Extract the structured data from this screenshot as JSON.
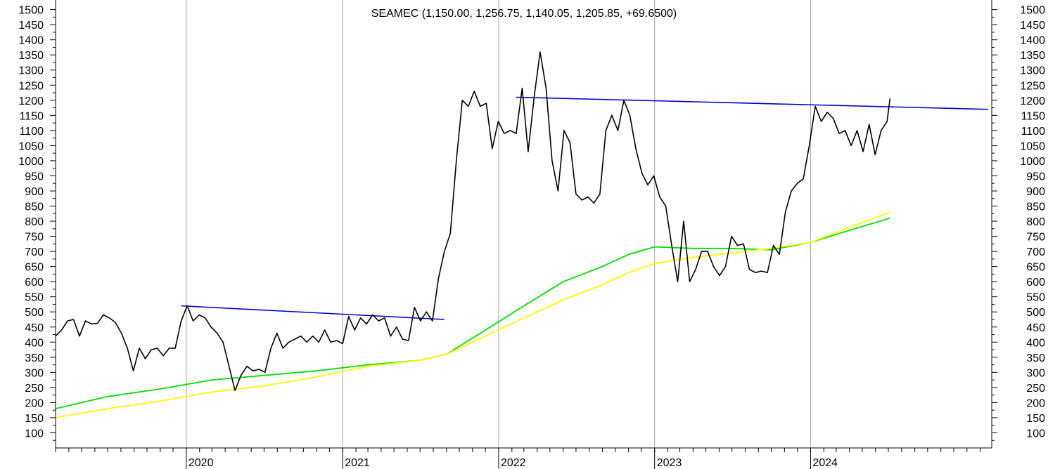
{
  "chart_data": {
    "type": "line",
    "title": "SEAMEC (1,150.00, 1,256.75, 1,140.05, 1,205.85, +69.6500)",
    "xlabel": "",
    "ylabel": "",
    "ylim": [
      50,
      1520
    ],
    "xlim": [
      "2019-03-01",
      "2025-02-28"
    ],
    "yticks": [
      100,
      150,
      200,
      250,
      300,
      350,
      400,
      450,
      500,
      550,
      600,
      650,
      700,
      750,
      800,
      850,
      900,
      950,
      1000,
      1050,
      1100,
      1150,
      1200,
      1250,
      1300,
      1350,
      1400,
      1450,
      1500
    ],
    "year_ticks": [
      {
        "date": "2020-01-01",
        "label": "2020"
      },
      {
        "date": "2021-01-01",
        "label": "2021"
      },
      {
        "date": "2022-01-01",
        "label": "2022"
      },
      {
        "date": "2023-01-01",
        "label": "2023"
      },
      {
        "date": "2024-01-01",
        "label": "2024"
      }
    ],
    "grid": "vertical-years",
    "colors": {
      "price": "#000000",
      "ma_fast": "#00dd00",
      "ma_slow": "#ffff00",
      "trendline": "#0000cc",
      "grid": "#b0b0b0"
    },
    "series": [
      {
        "key": "price",
        "points": [
          [
            "2019-03-01",
            420
          ],
          [
            "2019-03-15",
            440
          ],
          [
            "2019-03-29",
            470
          ],
          [
            "2019-04-12",
            475
          ],
          [
            "2019-04-26",
            420
          ],
          [
            "2019-05-10",
            470
          ],
          [
            "2019-05-24",
            460
          ],
          [
            "2019-06-07",
            462
          ],
          [
            "2019-06-21",
            490
          ],
          [
            "2019-07-05",
            480
          ],
          [
            "2019-07-19",
            465
          ],
          [
            "2019-08-02",
            430
          ],
          [
            "2019-08-16",
            380
          ],
          [
            "2019-08-30",
            305
          ],
          [
            "2019-09-13",
            380
          ],
          [
            "2019-09-27",
            345
          ],
          [
            "2019-10-11",
            375
          ],
          [
            "2019-10-25",
            380
          ],
          [
            "2019-11-08",
            355
          ],
          [
            "2019-11-22",
            380
          ],
          [
            "2019-12-06",
            380
          ],
          [
            "2019-12-20",
            470
          ],
          [
            "2020-01-03",
            520
          ],
          [
            "2020-01-17",
            470
          ],
          [
            "2020-01-31",
            490
          ],
          [
            "2020-02-14",
            480
          ],
          [
            "2020-02-28",
            450
          ],
          [
            "2020-03-13",
            430
          ],
          [
            "2020-03-27",
            400
          ],
          [
            "2020-04-10",
            320
          ],
          [
            "2020-04-24",
            240
          ],
          [
            "2020-05-08",
            290
          ],
          [
            "2020-05-22",
            320
          ],
          [
            "2020-06-05",
            305
          ],
          [
            "2020-06-19",
            310
          ],
          [
            "2020-07-03",
            300
          ],
          [
            "2020-07-17",
            380
          ],
          [
            "2020-07-31",
            430
          ],
          [
            "2020-08-14",
            380
          ],
          [
            "2020-08-28",
            400
          ],
          [
            "2020-09-11",
            410
          ],
          [
            "2020-09-25",
            420
          ],
          [
            "2020-10-09",
            400
          ],
          [
            "2020-10-23",
            420
          ],
          [
            "2020-11-06",
            400
          ],
          [
            "2020-11-20",
            440
          ],
          [
            "2020-12-04",
            400
          ],
          [
            "2020-12-18",
            405
          ],
          [
            "2021-01-01",
            395
          ],
          [
            "2021-01-15",
            485
          ],
          [
            "2021-01-29",
            440
          ],
          [
            "2021-02-12",
            480
          ],
          [
            "2021-02-26",
            460
          ],
          [
            "2021-03-12",
            490
          ],
          [
            "2021-03-26",
            470
          ],
          [
            "2021-04-09",
            480
          ],
          [
            "2021-04-23",
            420
          ],
          [
            "2021-05-07",
            450
          ],
          [
            "2021-05-21",
            410
          ],
          [
            "2021-06-04",
            405
          ],
          [
            "2021-06-18",
            515
          ],
          [
            "2021-07-02",
            470
          ],
          [
            "2021-07-16",
            500
          ],
          [
            "2021-07-30",
            470
          ],
          [
            "2021-08-13",
            610
          ],
          [
            "2021-08-27",
            700
          ],
          [
            "2021-09-10",
            760
          ],
          [
            "2021-09-24",
            1000
          ],
          [
            "2021-10-08",
            1200
          ],
          [
            "2021-10-22",
            1180
          ],
          [
            "2021-11-05",
            1230
          ],
          [
            "2021-11-19",
            1180
          ],
          [
            "2021-12-03",
            1190
          ],
          [
            "2021-12-17",
            1040
          ],
          [
            "2021-12-31",
            1130
          ],
          [
            "2022-01-14",
            1090
          ],
          [
            "2022-01-28",
            1100
          ],
          [
            "2022-02-11",
            1090
          ],
          [
            "2022-02-25",
            1240
          ],
          [
            "2022-03-11",
            1030
          ],
          [
            "2022-03-25",
            1210
          ],
          [
            "2022-04-08",
            1360
          ],
          [
            "2022-04-22",
            1240
          ],
          [
            "2022-05-06",
            1000
          ],
          [
            "2022-05-20",
            900
          ],
          [
            "2022-06-03",
            1100
          ],
          [
            "2022-06-17",
            1060
          ],
          [
            "2022-07-01",
            890
          ],
          [
            "2022-07-15",
            870
          ],
          [
            "2022-07-29",
            880
          ],
          [
            "2022-08-12",
            860
          ],
          [
            "2022-08-26",
            890
          ],
          [
            "2022-09-09",
            1100
          ],
          [
            "2022-09-23",
            1150
          ],
          [
            "2022-10-07",
            1100
          ],
          [
            "2022-10-21",
            1200
          ],
          [
            "2022-11-04",
            1150
          ],
          [
            "2022-11-18",
            1040
          ],
          [
            "2022-12-02",
            960
          ],
          [
            "2022-12-16",
            920
          ],
          [
            "2022-12-30",
            950
          ],
          [
            "2023-01-13",
            880
          ],
          [
            "2023-01-27",
            850
          ],
          [
            "2023-02-10",
            720
          ],
          [
            "2023-02-24",
            600
          ],
          [
            "2023-03-10",
            800
          ],
          [
            "2023-03-24",
            600
          ],
          [
            "2023-04-07",
            640
          ],
          [
            "2023-04-21",
            700
          ],
          [
            "2023-05-05",
            700
          ],
          [
            "2023-05-19",
            650
          ],
          [
            "2023-06-02",
            620
          ],
          [
            "2023-06-16",
            650
          ],
          [
            "2023-06-30",
            750
          ],
          [
            "2023-07-14",
            720
          ],
          [
            "2023-07-28",
            725
          ],
          [
            "2023-08-11",
            640
          ],
          [
            "2023-08-25",
            630
          ],
          [
            "2023-09-08",
            635
          ],
          [
            "2023-09-22",
            630
          ],
          [
            "2023-10-06",
            720
          ],
          [
            "2023-10-20",
            690
          ],
          [
            "2023-11-03",
            830
          ],
          [
            "2023-11-17",
            900
          ],
          [
            "2023-12-01",
            925
          ],
          [
            "2023-12-15",
            940
          ],
          [
            "2023-12-29",
            1050
          ],
          [
            "2024-01-12",
            1180
          ],
          [
            "2024-01-26",
            1130
          ],
          [
            "2024-02-09",
            1160
          ],
          [
            "2024-02-23",
            1140
          ],
          [
            "2024-03-08",
            1090
          ],
          [
            "2024-03-22",
            1100
          ],
          [
            "2024-04-05",
            1050
          ],
          [
            "2024-04-19",
            1100
          ],
          [
            "2024-05-03",
            1030
          ],
          [
            "2024-05-17",
            1120
          ],
          [
            "2024-05-31",
            1020
          ],
          [
            "2024-06-14",
            1100
          ],
          [
            "2024-06-28",
            1130
          ],
          [
            "2024-07-05",
            1205.85
          ]
        ]
      },
      {
        "key": "ma_fast",
        "points": [
          [
            "2019-03-01",
            180
          ],
          [
            "2019-07-01",
            220
          ],
          [
            "2019-11-01",
            245
          ],
          [
            "2020-03-01",
            275
          ],
          [
            "2020-07-01",
            290
          ],
          [
            "2020-11-01",
            305
          ],
          [
            "2021-03-01",
            325
          ],
          [
            "2021-07-01",
            340
          ],
          [
            "2021-09-01",
            360
          ],
          [
            "2021-12-01",
            440
          ],
          [
            "2022-03-01",
            520
          ],
          [
            "2022-06-01",
            600
          ],
          [
            "2022-09-01",
            650
          ],
          [
            "2022-11-01",
            690
          ],
          [
            "2023-01-01",
            715
          ],
          [
            "2023-04-01",
            710
          ],
          [
            "2023-07-01",
            710
          ],
          [
            "2023-10-01",
            705
          ],
          [
            "2024-01-01",
            730
          ],
          [
            "2024-04-01",
            770
          ],
          [
            "2024-07-05",
            810
          ]
        ]
      },
      {
        "key": "ma_slow",
        "points": [
          [
            "2019-03-01",
            150
          ],
          [
            "2019-07-01",
            180
          ],
          [
            "2019-11-01",
            205
          ],
          [
            "2020-03-01",
            235
          ],
          [
            "2020-07-01",
            255
          ],
          [
            "2020-11-01",
            285
          ],
          [
            "2021-03-01",
            320
          ],
          [
            "2021-07-01",
            340
          ],
          [
            "2021-09-01",
            360
          ],
          [
            "2021-12-01",
            420
          ],
          [
            "2022-03-01",
            480
          ],
          [
            "2022-06-01",
            540
          ],
          [
            "2022-09-01",
            590
          ],
          [
            "2022-11-01",
            630
          ],
          [
            "2023-01-01",
            660
          ],
          [
            "2023-04-01",
            680
          ],
          [
            "2023-07-01",
            695
          ],
          [
            "2023-10-01",
            710
          ],
          [
            "2024-01-01",
            730
          ],
          [
            "2024-04-01",
            780
          ],
          [
            "2024-07-05",
            830
          ]
        ]
      }
    ],
    "trendlines": [
      {
        "from": [
          "2019-12-20",
          520
        ],
        "to": [
          "2021-08-27",
          475
        ]
      },
      {
        "from": [
          "2022-02-11",
          1210
        ],
        "to": [
          "2025-02-20",
          1170
        ]
      }
    ]
  }
}
